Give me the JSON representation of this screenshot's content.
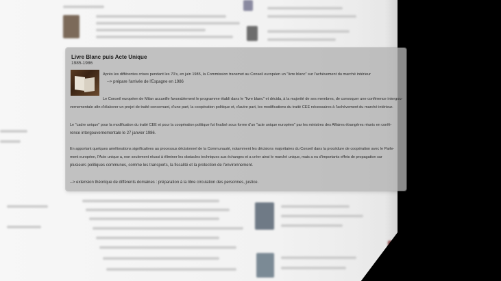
{
  "card": {
    "title": "Livre Blanc puis Acte Unique",
    "years": "1985-1986",
    "image_icon": "open-book-icon",
    "p1_line1": "Après les différentes crises pendant les 70's, en juin 1985, la Commission transmet au Conseil européen un \"livre blanc\" sur l'achèvement du marché intérieur",
    "p1_line2": "--> prépare l'arrivée de l'Espagne en 1986",
    "p2_line1": "Le Conseil européen de Milan accueille favorablement le programme établi dans le \"livre blanc\" et décida, à la majorité de ses membres, de convoquer une conférence intergou-",
    "p2_line2": "vernementale afin d'élaborer un projet de traité concernant, d'une part, la coopération politique et, d'autre part, les modifications du traité CEE nécessaires à l'achèvement du marché intérieur.",
    "p3_line1": "Le \"cadre unique\" pour la modification du traité CEE et pour la coopération politique fut finalisé sous forme d'un \"acte unique européen\" par les ministres des Affaires étrangères réunis en confé-",
    "p3_line2": "rence intergouvernementale le 27 janvier 1986.",
    "p4_line1": "En apportant quelques améliorations significatives au processus décisionnel de la Communauté, notamment les décisions majoritaires du Conseil dans la procédure de coopération avec le Parle-",
    "p4_line2": "ment européen, l'Acte unique a, non seulement réussi à éliminer les obstacles techniques aux échanges et a créer ainsi le marché unique, mais a eu d'importants effets de propagation sur",
    "p4_line3": "plusieurs politiques communes, comme les transports, la fiscalité et la protection de l'environnement.",
    "p5_line1": "--> extension théorique de différents domaines : préparation à la libre circulation des personnes, justice."
  },
  "colors": {
    "background": "#000000",
    "card_bg": "#b2b2b2",
    "text": "#2b2b2b"
  }
}
